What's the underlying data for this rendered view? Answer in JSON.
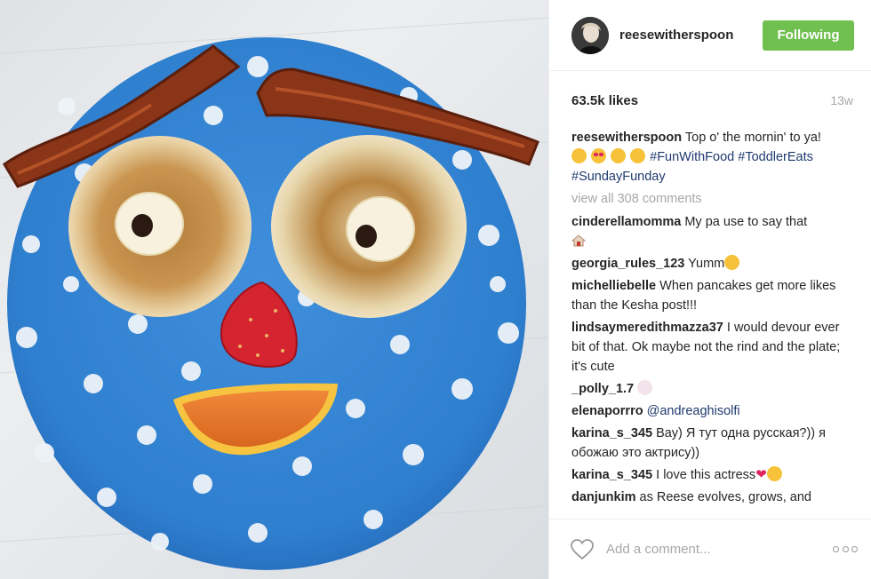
{
  "post": {
    "username": "reesewitherspoon",
    "follow_label": "Following",
    "likes": "63.5k likes",
    "time": "13w",
    "caption": {
      "username": "reesewitherspoon",
      "text": "Top o' the mornin' to ya!",
      "emojis": [
        "grinning-face",
        "heart-eyes-face",
        "smiling-face",
        "grinning-face"
      ],
      "hashtags": [
        "#FunWithFood",
        "#ToddlerEats",
        "#SundayFunday"
      ]
    },
    "view_all": "view all 308 comments",
    "comments": [
      {
        "user": "cinderellamomma",
        "text": "My pa use to say that"
      },
      {
        "user": "georgia_rules_123",
        "text": "Yumm"
      },
      {
        "user": "michelliebelle",
        "text": "When pancakes get more likes than the Kesha post!!!"
      },
      {
        "user": "lindsaymeredithmazza37",
        "text": "I would devour ever bit of that. Ok maybe not the rind and the plate; it's cute"
      },
      {
        "user": "_polly_1.7",
        "text": ""
      },
      {
        "user": "elenaporrro",
        "text": "@andreaghisolfi"
      },
      {
        "user": "karina_s_345",
        "text": "Вау) Я тут одна русская?)) я обожаю это актрису))"
      },
      {
        "user": "karina_s_345",
        "text": "I love this actress"
      },
      {
        "user": "danjunkim",
        "text": "as Reese evolves, grows, and"
      }
    ],
    "comment_placeholder": "Add a comment...",
    "colors": {
      "follow_green": "#70c050",
      "hashtag_blue": "#1f3a6e",
      "muted_gray": "#a5a7aa",
      "plate_blue": "#3b86d4"
    }
  }
}
